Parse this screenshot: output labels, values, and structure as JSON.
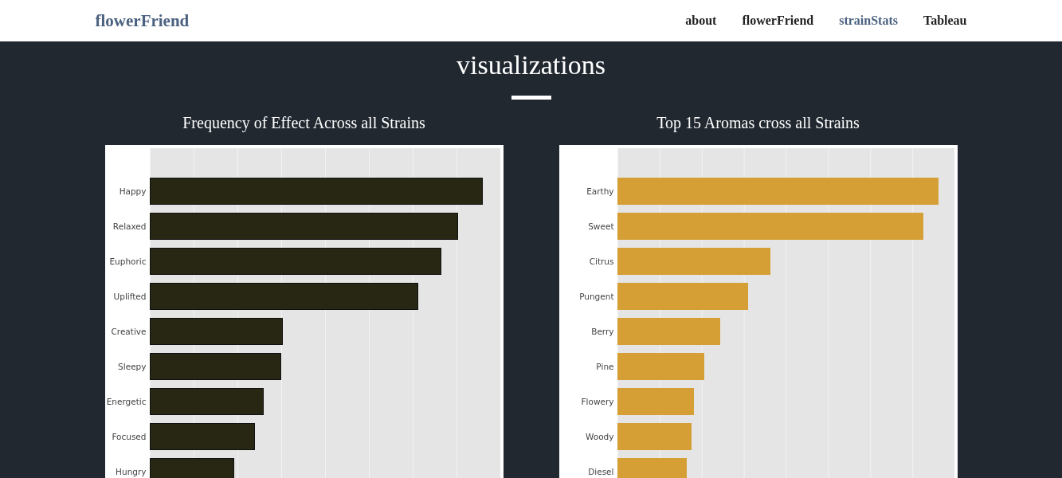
{
  "brand": "flowerFriend",
  "nav": [
    {
      "label": "about",
      "selected": false
    },
    {
      "label": "flowerFriend",
      "selected": false
    },
    {
      "label": "strainStats",
      "selected": true
    },
    {
      "label": "Tableau",
      "selected": false
    }
  ],
  "heading": "visualizations",
  "charts": [
    {
      "title": "Frequency of Effect Across all Strains",
      "kind": "dark",
      "bars": [
        {
          "label": "Happy",
          "level": 0.952
        },
        {
          "label": "Relaxed",
          "level": 0.88
        },
        {
          "label": "Euphoric",
          "level": 0.832
        },
        {
          "label": "Uplifted",
          "level": 0.768
        },
        {
          "label": "Creative",
          "level": 0.38
        },
        {
          "label": "Sleepy",
          "level": 0.375
        },
        {
          "label": "Energetic",
          "level": 0.327
        },
        {
          "label": "Focused",
          "level": 0.302
        },
        {
          "label": "Hungry",
          "level": 0.243
        }
      ]
    },
    {
      "title": "Top 15 Aromas cross all Strains",
      "kind": "gold",
      "bars": [
        {
          "label": "Earthy",
          "level": 0.953
        },
        {
          "label": "Sweet",
          "level": 0.908
        },
        {
          "label": "Citrus",
          "level": 0.454
        },
        {
          "label": "Pungent",
          "level": 0.388
        },
        {
          "label": "Berry",
          "level": 0.305
        },
        {
          "label": "Pine",
          "level": 0.258
        },
        {
          "label": "Flowery",
          "level": 0.229
        },
        {
          "label": "Woody",
          "level": 0.22
        },
        {
          "label": "Diesel",
          "level": 0.206
        }
      ]
    }
  ]
}
